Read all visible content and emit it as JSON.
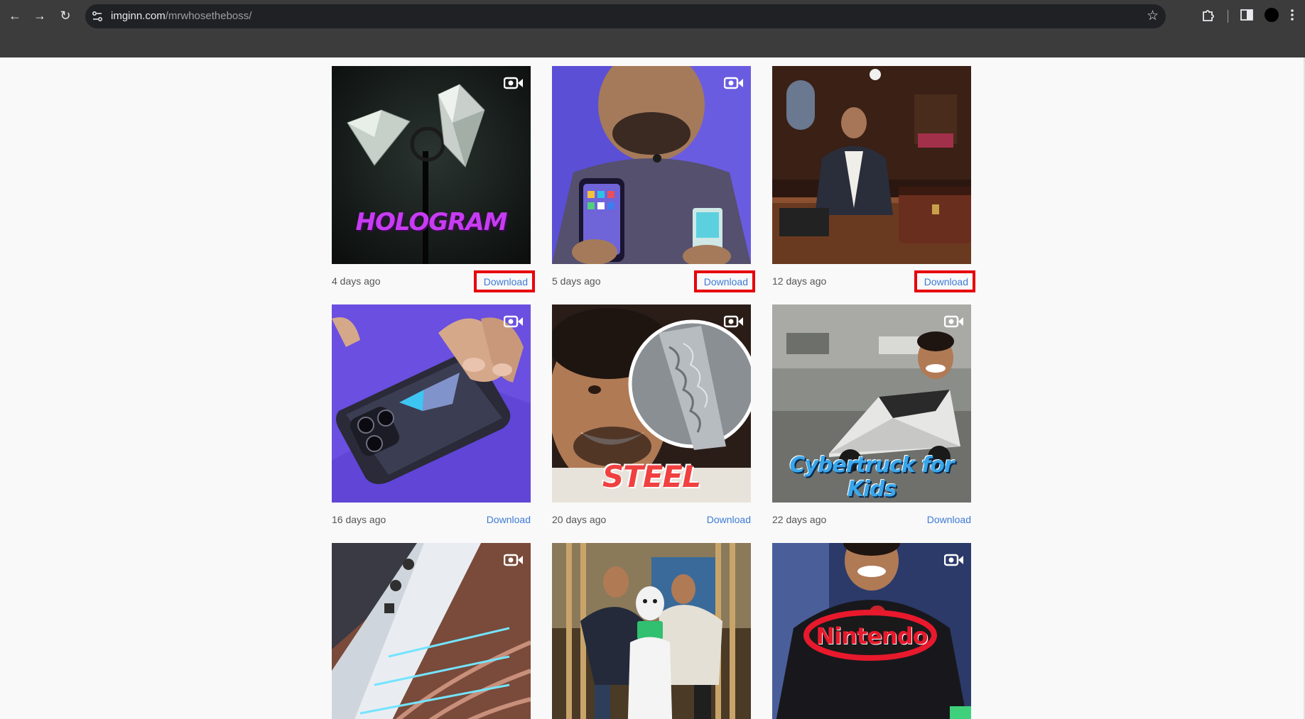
{
  "browser": {
    "url_host": "imginn.com",
    "url_path": "/mrwhosetheboss/"
  },
  "posts": [
    {
      "date": "4 days ago",
      "download_label": "Download",
      "highlighted": true,
      "thumb_text": "HOLOGRAM"
    },
    {
      "date": "5 days ago",
      "download_label": "Download",
      "highlighted": true,
      "thumb_text": ""
    },
    {
      "date": "12 days ago",
      "download_label": "Download",
      "highlighted": true,
      "thumb_text": ""
    },
    {
      "date": "16 days ago",
      "download_label": "Download",
      "highlighted": false,
      "thumb_text": ""
    },
    {
      "date": "20 days ago",
      "download_label": "Download",
      "highlighted": false,
      "thumb_text": "STEEL"
    },
    {
      "date": "22 days ago",
      "download_label": "Download",
      "highlighted": false,
      "thumb_text": "Cybertruck for Kids"
    },
    {
      "date": "",
      "download_label": "",
      "highlighted": false,
      "thumb_text": ""
    },
    {
      "date": "",
      "download_label": "",
      "highlighted": false,
      "thumb_text": ""
    },
    {
      "date": "",
      "download_label": "",
      "highlighted": false,
      "thumb_text": "Nintendo"
    }
  ],
  "colors": {
    "highlight": "#e8000b",
    "link": "#3d7bd6",
    "toolbar": "#3c3c3c"
  }
}
